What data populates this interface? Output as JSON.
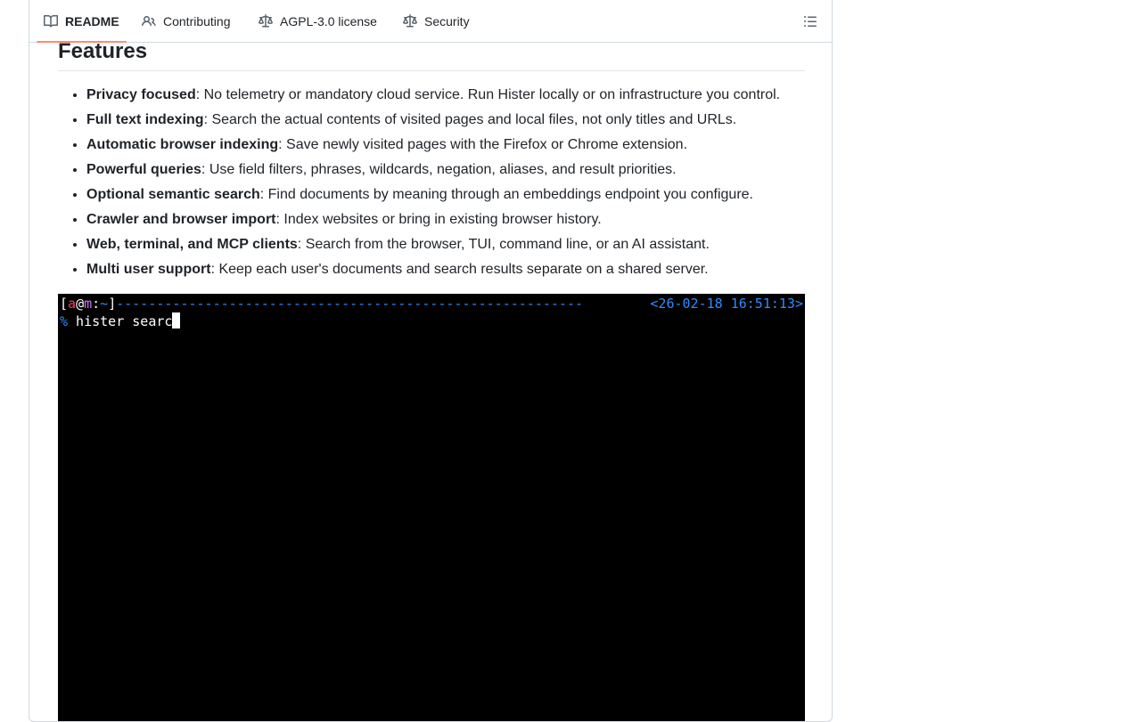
{
  "tabs": [
    {
      "label": "README",
      "icon": "book-icon",
      "active": true
    },
    {
      "label": "Contributing",
      "icon": "people-icon",
      "active": false
    },
    {
      "label": "AGPL-3.0 license",
      "icon": "law-icon",
      "active": false
    },
    {
      "label": "Security",
      "icon": "law-icon",
      "active": false
    }
  ],
  "toc_icon": "list-unordered-icon",
  "features": {
    "heading": "Features",
    "items": [
      {
        "title": "Privacy focused",
        "text": ": No telemetry or mandatory cloud service. Run Hister locally or on infrastructure you control."
      },
      {
        "title": "Full text indexing",
        "text": ": Search the actual contents of visited pages and local files, not only titles and URLs."
      },
      {
        "title": "Automatic browser indexing",
        "text": ": Save newly visited pages with the Firefox or Chrome extension."
      },
      {
        "title": "Powerful queries",
        "text": ": Use field filters, phrases, wildcards, negation, aliases, and result priorities."
      },
      {
        "title": "Optional semantic search",
        "text": ": Find documents by meaning through an embeddings endpoint you configure."
      },
      {
        "title": "Crawler and browser import",
        "text": ": Index websites or bring in existing browser history."
      },
      {
        "title": "Web, terminal, and MCP clients",
        "text": ": Search from the browser, TUI, command line, or an AI assistant."
      },
      {
        "title": "Multi user support",
        "text": ": Keep each user's documents and search results separate on a shared server."
      }
    ]
  },
  "terminal": {
    "open_bracket": "[",
    "user": "a",
    "at": "@",
    "host": "m",
    "sep": ":",
    "dir": "~",
    "close_bracket": "]",
    "dashes": "----------------------------------------------------------",
    "timestamp": "<26-02-18 16:51:13>",
    "prompt": "%",
    "command": " hister searc"
  },
  "colors": {
    "tab_underline": "#fd8c73",
    "terminal_bg": "#000000",
    "term_red": "#ff3b5c",
    "term_magenta": "#d86bff",
    "term_blue": "#2f8cff"
  }
}
